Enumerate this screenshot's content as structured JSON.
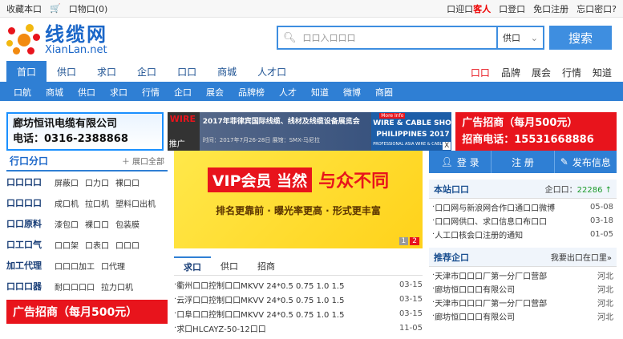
{
  "topbar": {
    "bookmark": "收藏本口",
    "cart": "口物口(0)",
    "login_prefix": "口迎口",
    "guest": "客人",
    "login": "口登口",
    "register": "免口注册",
    "forgot": "忘口密口?"
  },
  "logo": {
    "cn": "线缆网",
    "en": "XianLan.net"
  },
  "search": {
    "placeholder": "口口入口口口",
    "type": "供口",
    "button": "搜索"
  },
  "nav1": {
    "items": [
      "首口",
      "供口",
      "求口",
      "企口",
      "口口",
      "商城",
      "人才口"
    ],
    "right": [
      "口口",
      "品牌",
      "展会",
      "行情",
      "知道"
    ]
  },
  "nav2": {
    "items": [
      "口航",
      "商城",
      "供口",
      "求口",
      "行情",
      "企口",
      "展会",
      "品牌榜",
      "人才",
      "知道",
      "微博",
      "商圈"
    ]
  },
  "ads": {
    "left": [
      "廊坊恒讯电缆有限公司",
      "电话：0316-2388868"
    ],
    "middle_title": "2017年菲律宾国际线缆、线材及线缆设备展览会",
    "middle_sub": "时间：2017年7月26-28日   展馆：SMX-马尼拉",
    "middle_tag": "WIRE",
    "middle_promo": "推广",
    "middle_more": "More Info",
    "right_title": "WIRE & CABLE SHOW",
    "right_sub": "PHILIPPINES 2017",
    "right_caption": "PROFESSIONAL ASIA WIRE & CABLE",
    "close": "X",
    "red": [
      "广告招商（每月500元）",
      "招商电话：15531668886"
    ]
  },
  "categories": {
    "title": "行口分口",
    "expand": "展口全部",
    "rows": [
      {
        "head": "口口口口",
        "items": [
          "屏蔽口",
          "口力口",
          "裸口口"
        ]
      },
      {
        "head": "口口口口",
        "items": [
          "成口机",
          "拉口机",
          "塑料口出机"
        ]
      },
      {
        "head": "口口原料",
        "items": [
          "漆包口",
          "裸口口",
          "包装膜"
        ]
      },
      {
        "head": "口工口气",
        "items": [
          "口口架",
          "口表口",
          "口口口"
        ]
      },
      {
        "head": "加工代理",
        "items": [
          "口口口加工",
          "口代理"
        ]
      },
      {
        "head": "口口口器",
        "items": [
          "耐口口口口",
          "拉力口机"
        ]
      }
    ],
    "red_ad": "广告招商（每月500元）"
  },
  "banner": {
    "line1a": "VIP会员 当然",
    "line1b": "与众不同",
    "line2": "排名更靠前 · 曝光率更高 · 形式更丰富",
    "pages": [
      "1",
      "2"
    ]
  },
  "tabs": {
    "items": [
      "求口",
      "供口",
      "招商"
    ],
    "rows": [
      {
        "tx": "衢州口口控制口口MKVV 24*0.5 0.75 1.0 1.5",
        "dt": "03-15"
      },
      {
        "tx": "云浮口口控制口口MKVV 24*0.5 0.75 1.0 1.5",
        "dt": "03-15"
      },
      {
        "tx": "口阜口口控制口口MKVV 24*0.5 0.75 1.0 1.5",
        "dt": "03-15"
      },
      {
        "tx": "求口HLCAYZ-50-12口口",
        "dt": "11-05"
      }
    ]
  },
  "user": {
    "login": "登 录",
    "register": "注 册",
    "publish": "发布信息"
  },
  "notice": {
    "title": "本站口口",
    "count_label": "企口口：",
    "count": "22286",
    "rows": [
      {
        "tx": "口口网与新浪网合作口通口口微博",
        "dt": "05-08"
      },
      {
        "tx": "口口网供口、求口信息口布口口",
        "dt": "03-18"
      },
      {
        "tx": "人工口核会口注册的通知",
        "dt": "01-05"
      }
    ]
  },
  "recommend": {
    "title": "推荐企口",
    "hint": "我要出口在口里»",
    "rows": [
      {
        "tx": "天津市口口口厂第一分厂口营部",
        "dt": "河北"
      },
      {
        "tx": "廊坊恒口口口有限公司",
        "dt": "河北"
      },
      {
        "tx": "天津市口口口厂第一分厂口营部",
        "dt": "河北"
      },
      {
        "tx": "廊坊恒口口口有限公司",
        "dt": "河北"
      }
    ]
  },
  "colors": {
    "primary": "#2f7fd4",
    "accent": "#e8141c"
  }
}
